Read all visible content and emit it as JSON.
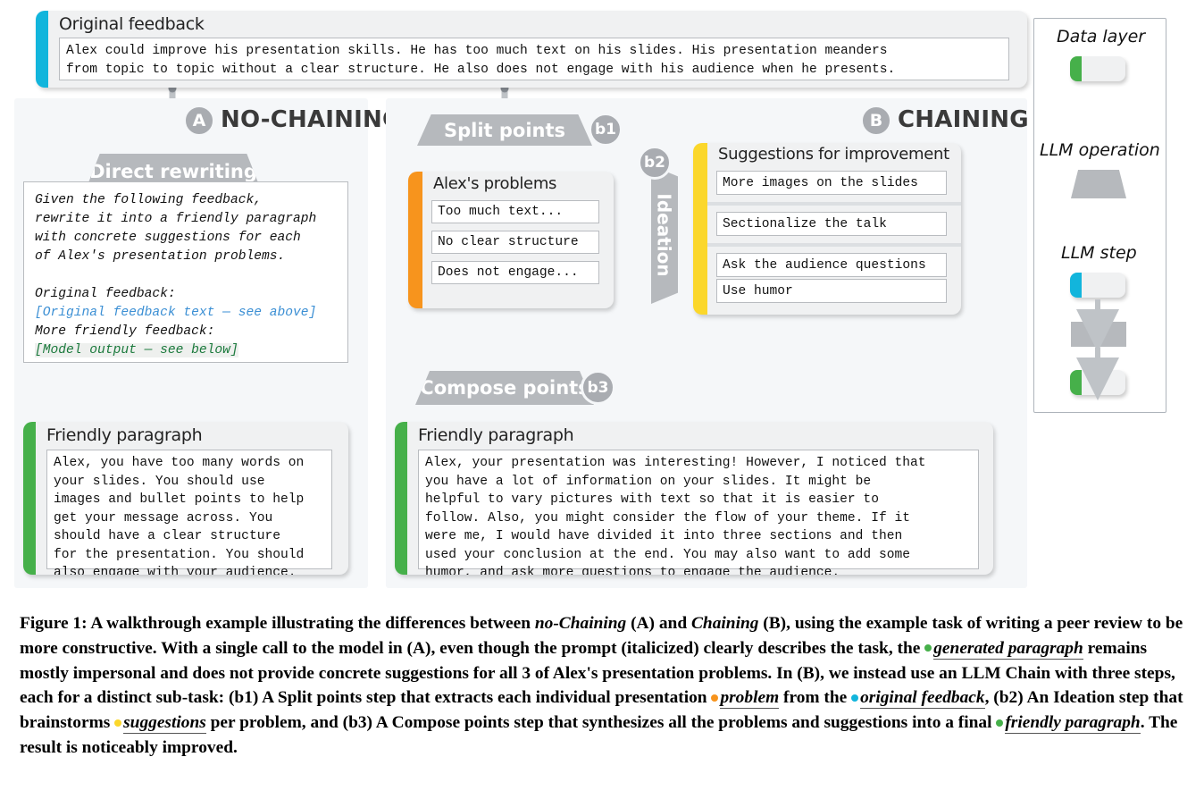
{
  "colors": {
    "cyan": "#12b5dc",
    "orange": "#f7941d",
    "yellow": "#fbd72b",
    "green": "#46b04a",
    "gray_op": "#b6b9bd",
    "panel_bg": "#f5f7f9"
  },
  "original_feedback": {
    "title": "Original feedback",
    "lines": [
      "Alex could improve his presentation skills. He has too much text on his slides. His presentation meanders",
      "from topic to topic without a clear structure. He also does not engage with his audience when he presents."
    ]
  },
  "section_a": {
    "badge": "A",
    "label": "NO-CHAINING",
    "operation": "Direct rewriting",
    "prompt": {
      "italic_lines": [
        "Given the following feedback,",
        "rewrite it into a friendly paragraph",
        "with concrete suggestions for each",
        "of Alex's presentation problems.",
        "",
        "Original feedback:"
      ],
      "blue_line": "[Original feedback text — see above]",
      "italic_line2": "More friendly feedback:",
      "green_line": "[Model output — see below]"
    },
    "output": {
      "title": "Friendly paragraph",
      "lines": [
        "Alex, you have too many words on",
        "your slides. You should use",
        "images and bullet points to help",
        "get your message across. You",
        "should have a clear structure",
        "for the presentation. You should",
        "also engage with your audience."
      ]
    }
  },
  "section_b": {
    "badge": "B",
    "label": "CHAINING",
    "steps": [
      {
        "id": "b1",
        "operation": "Split points"
      },
      {
        "id": "b2",
        "operation": "Ideation"
      },
      {
        "id": "b3",
        "operation": "Compose points"
      }
    ],
    "problems": {
      "title": "Alex's problems",
      "items": [
        "Too much text...",
        "No clear structure",
        "Does not engage..."
      ]
    },
    "suggestions": {
      "title": "Suggestions for improvement",
      "groups": [
        [
          "More images on the slides"
        ],
        [
          "Sectionalize the talk"
        ],
        [
          "Ask the audience questions",
          "Use humor"
        ]
      ]
    },
    "output": {
      "title": "Friendly paragraph",
      "lines": [
        "Alex, your presentation was interesting! However, I noticed that",
        "you have a lot of information on your slides. It might be",
        "helpful to vary pictures with text so that it is easier to",
        "follow. Also, you might consider the flow of your theme. If it",
        "were me, I would have divided it into three sections and then",
        "used your conclusion at the end. You may also want to add some",
        "humor, and ask more questions to engage the audience."
      ]
    }
  },
  "legend": {
    "items": [
      {
        "label": "Data layer",
        "kind": "chip",
        "accent": "#46b04a"
      },
      {
        "label": "LLM operation",
        "kind": "trapezoid",
        "accent": "#b6b9bd"
      },
      {
        "label": "LLM step",
        "kind": "step",
        "accent_in": "#12b5dc",
        "accent_out": "#46b04a"
      }
    ]
  },
  "caption": {
    "figure_label": "Figure 1:",
    "p1a": " A walkthrough example illustrating the differences between ",
    "i1": "no-Chaining",
    "p1b": " (A) and ",
    "i2": "Chaining",
    "p1c": " (B), using the example task of writing a peer review to be more constructive. With a single call to the model in (A), even though the prompt (italicized) clearly describes the task, the ",
    "h1": "generated paragraph",
    "p1d": " remains mostly impersonal and does not provide concrete suggestions for all 3 of Alex's presentation problems. In (B), we instead use an LLM Chain with three steps, each for a distinct sub-task: (b1) A Split points step that extracts each individual presentation ",
    "h2": "problem",
    "p1e": " from the ",
    "h3": "original feedback",
    "p1f": ", (b2) An Ideation step that brainstorms ",
    "h4": "suggestions",
    "p1g": " per problem, and (b3) A Compose points step that synthesizes all the problems and suggestions into a final ",
    "h5": "friendly paragraph",
    "p1h": ". The result is noticeably improved."
  }
}
